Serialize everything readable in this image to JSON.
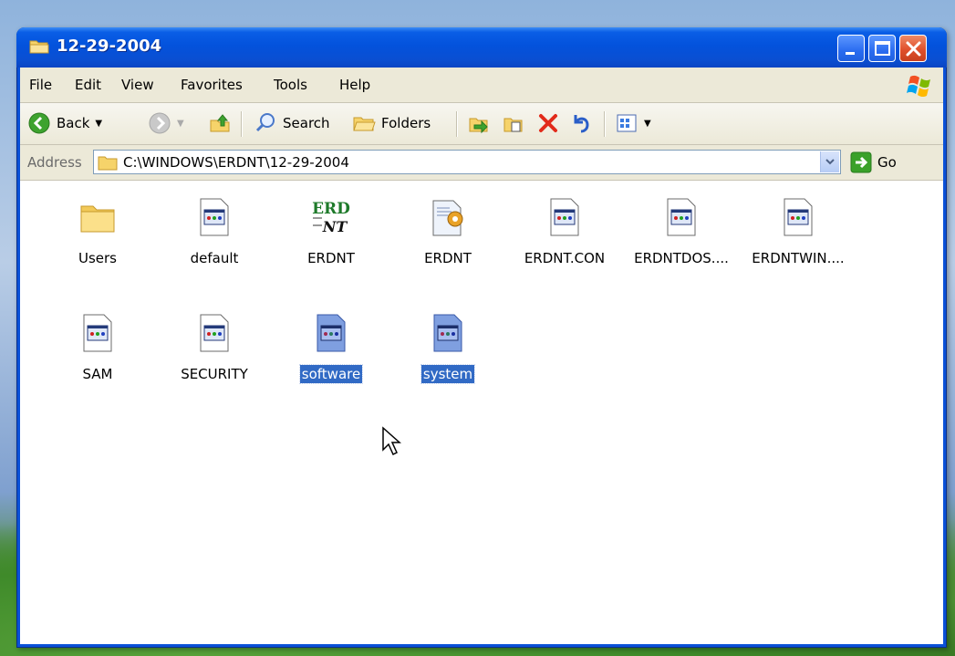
{
  "window": {
    "title": "12-29-2004",
    "controls": [
      "minimize-icon",
      "maximize-icon",
      "close-icon"
    ]
  },
  "menu": [
    "File",
    "Edit",
    "View",
    "Favorites",
    "Tools",
    "Help"
  ],
  "toolbar": {
    "back_label": "Back",
    "search_label": "Search",
    "folders_label": "Folders"
  },
  "address": {
    "label": "Address",
    "path": "C:\\WINDOWS\\ERDNT\\12-29-2004",
    "go_label": "Go"
  },
  "files": [
    {
      "name": "Users",
      "icon": "folder-icon",
      "selected": false
    },
    {
      "name": "default",
      "icon": "registry-file-icon",
      "selected": false
    },
    {
      "name": "ERDNT",
      "icon": "erdnt-logo-icon",
      "selected": false
    },
    {
      "name": "ERDNT",
      "icon": "config-file-icon",
      "selected": false
    },
    {
      "name": "ERDNT.CON",
      "icon": "registry-file-icon",
      "selected": false
    },
    {
      "name": "ERDNTDOS....",
      "icon": "registry-file-icon",
      "selected": false
    },
    {
      "name": "ERDNTWIN....",
      "icon": "registry-file-icon",
      "selected": false
    },
    {
      "name": "SAM",
      "icon": "registry-file-icon",
      "selected": false
    },
    {
      "name": "SECURITY",
      "icon": "registry-file-icon",
      "selected": false
    },
    {
      "name": "software",
      "icon": "registry-file-icon",
      "selected": true
    },
    {
      "name": "system",
      "icon": "registry-file-icon",
      "selected": true
    }
  ],
  "erd_logo": {
    "line1": "ERD",
    "line2": "NT"
  },
  "colors": {
    "titlebar": "#0352dc",
    "selection": "#316ac5",
    "chrome": "#ece9d8"
  }
}
